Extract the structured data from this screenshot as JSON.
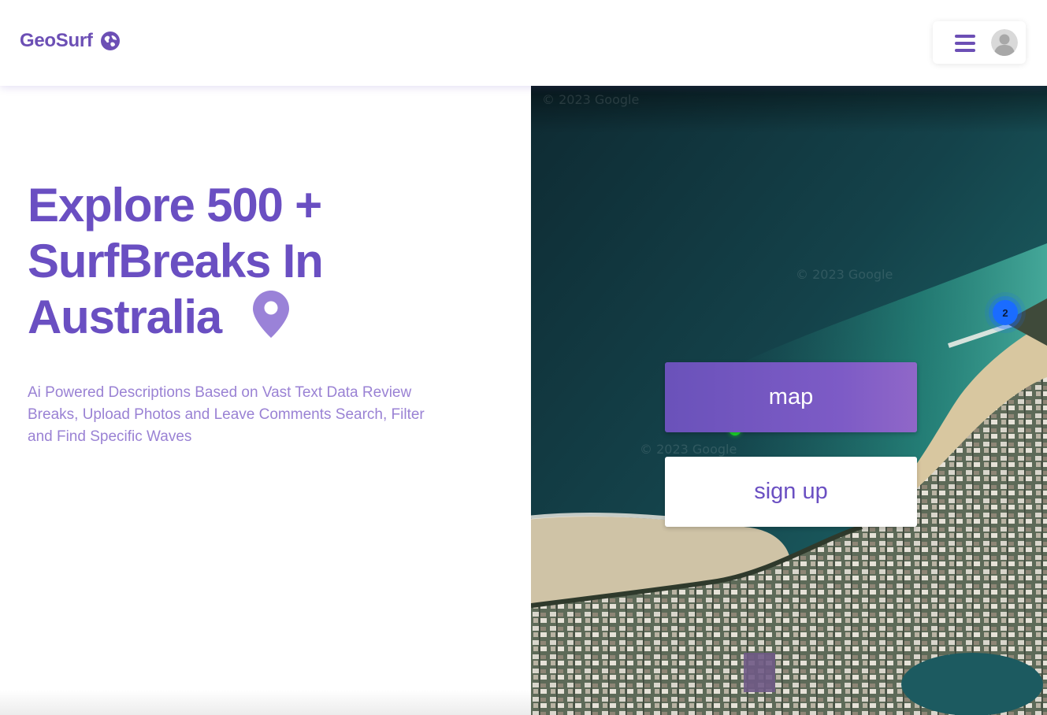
{
  "header": {
    "logo_text": "GeoSurf",
    "logo_icon": "globe-icon",
    "menu_icon": "hamburger-menu-icon",
    "avatar_icon": "user-avatar-icon"
  },
  "hero": {
    "headline_lines": [
      "Explore 500 +",
      "SurfBreaks In",
      "Australia"
    ],
    "headline_icon": "map-pin-icon",
    "subtitle": "Ai Powered Descriptions Based on Vast Text Data Review Breaks, Upload Photos and Leave Comments Search, Filter and Find Specific Waves"
  },
  "map": {
    "cluster_count": "2",
    "watermarks": [
      "© 2023 Google",
      "© 2023 Google",
      "© 2023 Google"
    ],
    "map_button_label": "map",
    "signup_button_label": "sign up"
  },
  "colors": {
    "brand_purple": "#6a4fc2",
    "subtitle_purple": "#9a82d4",
    "cluster_blue": "#1a6cff",
    "marker_green": "#1bdc2a"
  }
}
